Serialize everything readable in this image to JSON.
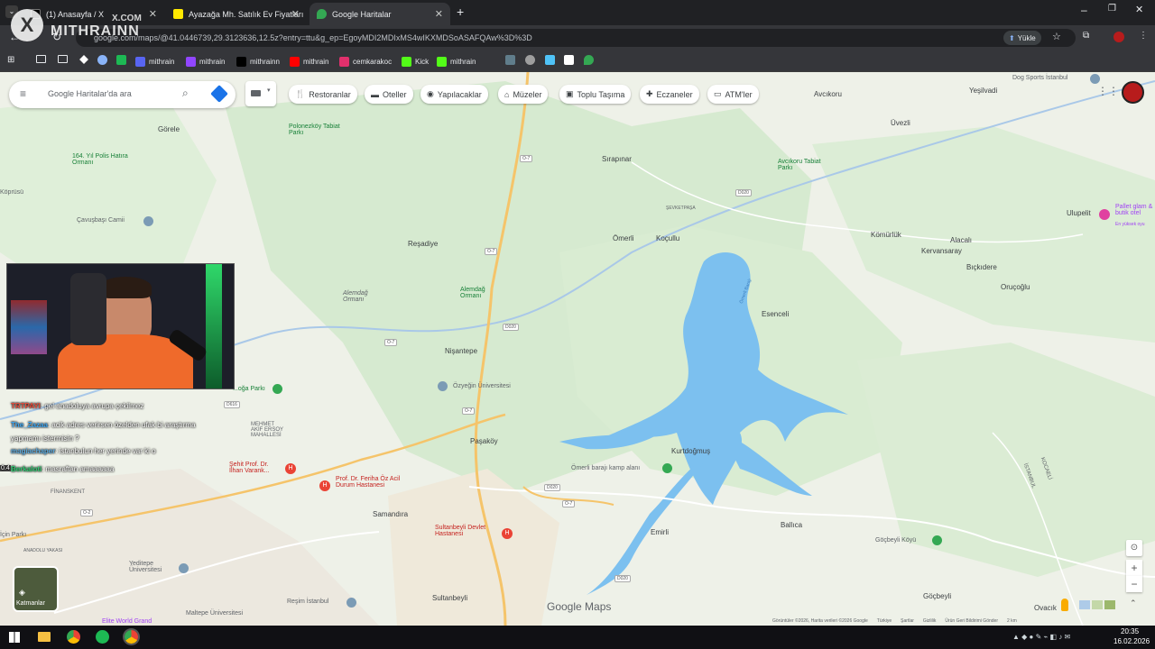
{
  "browser": {
    "tabs": [
      {
        "label": "(1) Anasayfa / X",
        "active": false
      },
      {
        "label": "Ayazağa Mh. Satılık Ev Fiyatları",
        "active": false
      },
      {
        "label": "Google Haritalar",
        "active": true
      }
    ],
    "url": "google.com/maps/@41.0446739,29.3123636,12.5z?entry=ttu&g_ep=EgoyMDI2MDIxMS4wIKXMDSoASAFQAw%3D%3D",
    "upload_label": "Yükle",
    "bookmarks": [
      "mithrain",
      "mithrain",
      "mithrainn",
      "mithrain",
      "cemkarakoc",
      "Kick",
      "mithrain"
    ]
  },
  "watermark": {
    "brand": "MITHRAINN",
    "subbrand": "X.COM"
  },
  "maps": {
    "search_placeholder": "Google Haritalar'da ara",
    "chips": [
      "Restoranlar",
      "Oteller",
      "Yapılacaklar",
      "Müzeler",
      "Toplu Taşıma",
      "Eczaneler",
      "ATM'ler"
    ],
    "layers_label": "Katmanlar",
    "logo": "Google Maps",
    "footer": [
      "Görüntüler ©2026, Harita verileri ©2026 Google",
      "Türkiye",
      "Şartlar",
      "Gizlilik",
      "Ürün Geri Bildirimi Gönder",
      "2 km"
    ],
    "places": [
      {
        "name": "Görele"
      },
      {
        "name": "164. Yıl Polis Hatıra Ormanı"
      },
      {
        "name": "Polonezköy Tabiat Parkı"
      },
      {
        "name": "Sırapınar"
      },
      {
        "name": "Avcıkoru"
      },
      {
        "name": "Yeşilvadi"
      },
      {
        "name": "Üvezli"
      },
      {
        "name": "Dog Sports İstanbul"
      },
      {
        "name": "Avcıkoru Tabiat Parkı"
      },
      {
        "name": "ŞEVKETPAŞA"
      },
      {
        "name": "Çavuşbaşı Camii"
      },
      {
        "name": "Reşadiye"
      },
      {
        "name": "Ömerli"
      },
      {
        "name": "Koçullu"
      },
      {
        "name": "Kömürlük"
      },
      {
        "name": "Kervansaray"
      },
      {
        "name": "Alacalı"
      },
      {
        "name": "Bıçkıdere"
      },
      {
        "name": "Ulupelit"
      },
      {
        "name": "Oruçoğlu"
      },
      {
        "name": "Alemdağ Ormanı"
      },
      {
        "name": "Alemdağ Ormanı"
      },
      {
        "name": "Esenceli"
      },
      {
        "name": "Nişantepe"
      },
      {
        "name": "Özyeğin Üniversitesi"
      },
      {
        "name": "Paşaköy"
      },
      {
        "name": "Kurtdoğmuş"
      },
      {
        "name": "Ömerli barajı kamp alanı"
      },
      {
        "name": "MEHMET AKİF ERSOY MAHALLESİ"
      },
      {
        "name": "Şehit Prof. Dr. İlhan Varank..."
      },
      {
        "name": "Prof. Dr. Feriha Öz Acil Durum Hastanesi"
      },
      {
        "name": "Samandıra"
      },
      {
        "name": "Sultanbeyli Devlet Hastanesi"
      },
      {
        "name": "Emirli"
      },
      {
        "name": "Ballıca"
      },
      {
        "name": "Göçbeyli Köyü"
      },
      {
        "name": "Göçbeyli"
      },
      {
        "name": "FİNANSKENT"
      },
      {
        "name": "Yeditepe Üniversitesi"
      },
      {
        "name": "Reşim İstanbul"
      },
      {
        "name": "Sultanbeyli"
      },
      {
        "name": "Maltepe Üniversitesi"
      },
      {
        "name": "Elite World Grand"
      },
      {
        "name": "ANADOLU YAKASI"
      },
      {
        "name": "İSTANBUL"
      },
      {
        "name": "KOCAELİ"
      },
      {
        "name": "Ovacık"
      },
      {
        "name": "...oğa Parkı"
      },
      {
        "name": "Pallet glam & butik otel"
      },
      {
        "name": "En yüksek oyu"
      },
      {
        "name": "Köprüsü"
      },
      {
        "name": "İçin Parkı"
      }
    ],
    "roads": [
      "O-7",
      "D020",
      "D616",
      "O-2",
      "Ömerli Barajı"
    ]
  },
  "stream": {
    "chat": [
      {
        "user": "TRTPAYI",
        "msg": ": gel anadoluya avrupa çekilmez"
      },
      {
        "user": "The_Zazaa",
        "msg": ": acik adres verirsen özelden ufak bi araştırma yapmamı istermisin ?"
      },
      {
        "user": "magiachaper",
        "msg": ": istanbulun her yerinde var ki o"
      },
      {
        "user": "Berkaloti",
        "msg": ": masraftan amaaaaaa"
      }
    ],
    "chat_badge": "0.4"
  },
  "taskbar": {
    "time": "20:35",
    "date": "16.02.2026"
  }
}
